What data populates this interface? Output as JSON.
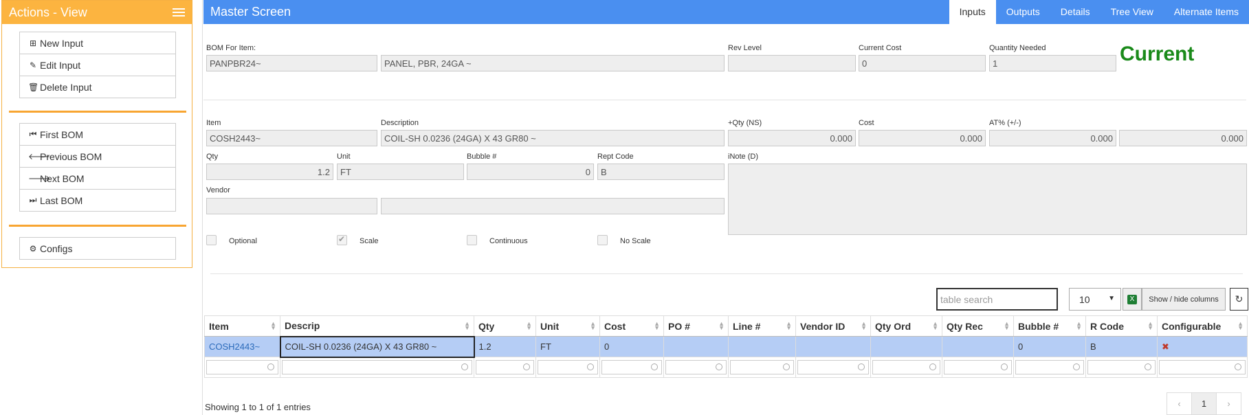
{
  "sidebar": {
    "title": "Actions - View",
    "group1": [
      {
        "label": "New Input",
        "icon": "plus-square-icon"
      },
      {
        "label": "Edit Input",
        "icon": "pencil-icon"
      },
      {
        "label": "Delete Input",
        "icon": "trash-icon"
      }
    ],
    "group2": [
      {
        "label": "First BOM",
        "icon": "step-backward-icon"
      },
      {
        "label": "Previous BOM",
        "icon": "arrow-left-icon"
      },
      {
        "label": "Next BOM",
        "icon": "arrow-right-icon"
      },
      {
        "label": "Last BOM",
        "icon": "step-forward-icon"
      }
    ],
    "group3": [
      {
        "label": "Configs",
        "icon": "cogs-icon"
      }
    ]
  },
  "header": {
    "title": "Master Screen",
    "tabs": [
      "Inputs",
      "Outputs",
      "Details",
      "Tree View",
      "Alternate Items"
    ],
    "active_tab": "Inputs"
  },
  "bom": {
    "label": "BOM For Item:",
    "item": "PANPBR24~",
    "description": "PANEL, PBR, 24GA ~",
    "rev_label": "Rev Level",
    "rev": "",
    "cost_label": "Current Cost",
    "cost": "0",
    "qty_label": "Quantity Needed",
    "qty": "1",
    "status": "Current"
  },
  "input": {
    "item_label": "Item",
    "item": "COSH2443~",
    "desc_label": "Description",
    "desc": "COIL-SH 0.0236 (24GA) X 43 GR80 ~",
    "qtyns_label": "+Qty (NS)",
    "qtyns": "0.000",
    "cost_label": "Cost",
    "cost": "0.000",
    "at_label": "AT% (+/-)",
    "at1": "0.000",
    "at2": "0.000",
    "qty_label": "Qty",
    "qty": "1.2",
    "unit_label": "Unit",
    "unit": "FT",
    "bubble_label": "Bubble #",
    "bubble": "0",
    "rept_label": "Rept Code",
    "rept": "B",
    "inote_label": "iNote (D)",
    "inote": "",
    "vendor_label": "Vendor",
    "vendor": "",
    "vendor_name": ""
  },
  "checkboxes": [
    {
      "label": "Optional",
      "checked": false
    },
    {
      "label": "Scale",
      "checked": true
    },
    {
      "label": "Continuous",
      "checked": false
    },
    {
      "label": "No Scale",
      "checked": false
    }
  ],
  "table_tools": {
    "search_placeholder": "table search",
    "page_size": "10",
    "showhide_label": "Show / hide columns"
  },
  "table": {
    "columns": [
      "Item",
      "Descrip",
      "Qty",
      "Unit",
      "Cost",
      "PO #",
      "Line #",
      "Vendor ID",
      "Qty Ord",
      "Qty Rec",
      "Bubble #",
      "R Code",
      "Configurable"
    ],
    "rows": [
      [
        "COSH2443~",
        "COIL-SH 0.0236 (24GA) X 43 GR80 ~",
        "1.2",
        "FT",
        "0",
        "",
        "",
        "",
        "",
        "",
        "0",
        "B",
        "✖"
      ]
    ]
  },
  "footer": {
    "showing": "Showing 1 to 1 of 1 entries",
    "pager": [
      "‹",
      "1",
      "›"
    ]
  }
}
